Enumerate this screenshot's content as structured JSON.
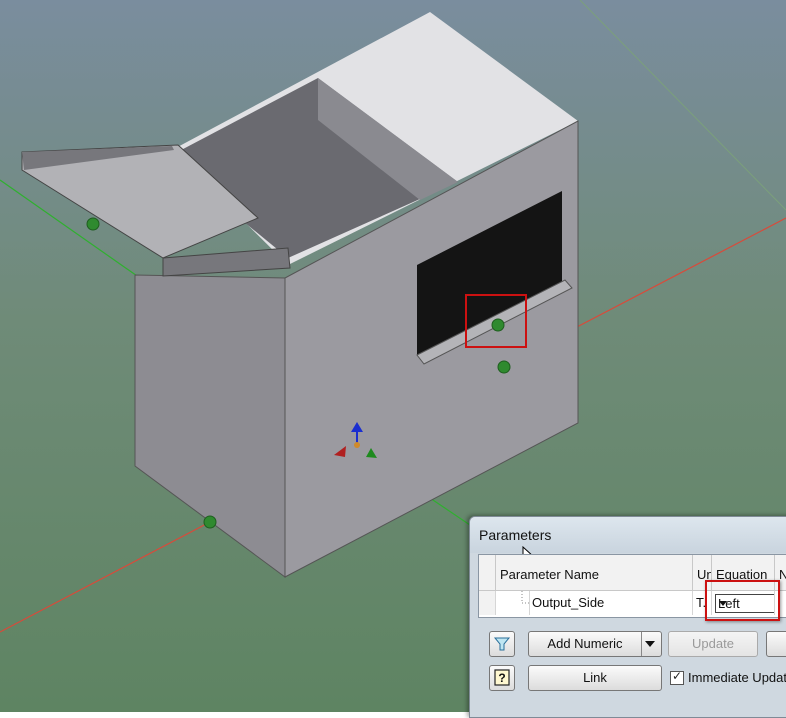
{
  "colors": {
    "ground": "#5e8462",
    "sky": "#7a8d9e",
    "x_axis": "#d94a3a",
    "y_axis": "#2e9a2e",
    "panel": "#8d8c92",
    "highlight": "#cc1111"
  },
  "viewport": {
    "model": "box-enclosure",
    "icons": [
      "triad-icon",
      "work-point-icon"
    ]
  },
  "parameters_dialog": {
    "title": "Parameters",
    "columns": [
      "Parameter Name",
      "Un",
      "Equation",
      "N"
    ],
    "rows": [
      {
        "name": "Output_Side",
        "unit": "T.",
        "equation": "Left"
      }
    ],
    "buttons": {
      "add_numeric": "Add Numeric",
      "update": "Update",
      "link": "Link"
    },
    "immediate_update": {
      "label": "Immediate Updat",
      "checked": true
    },
    "icons": [
      "filter-icon",
      "help-icon",
      "dropdown-arrow-icon"
    ]
  }
}
